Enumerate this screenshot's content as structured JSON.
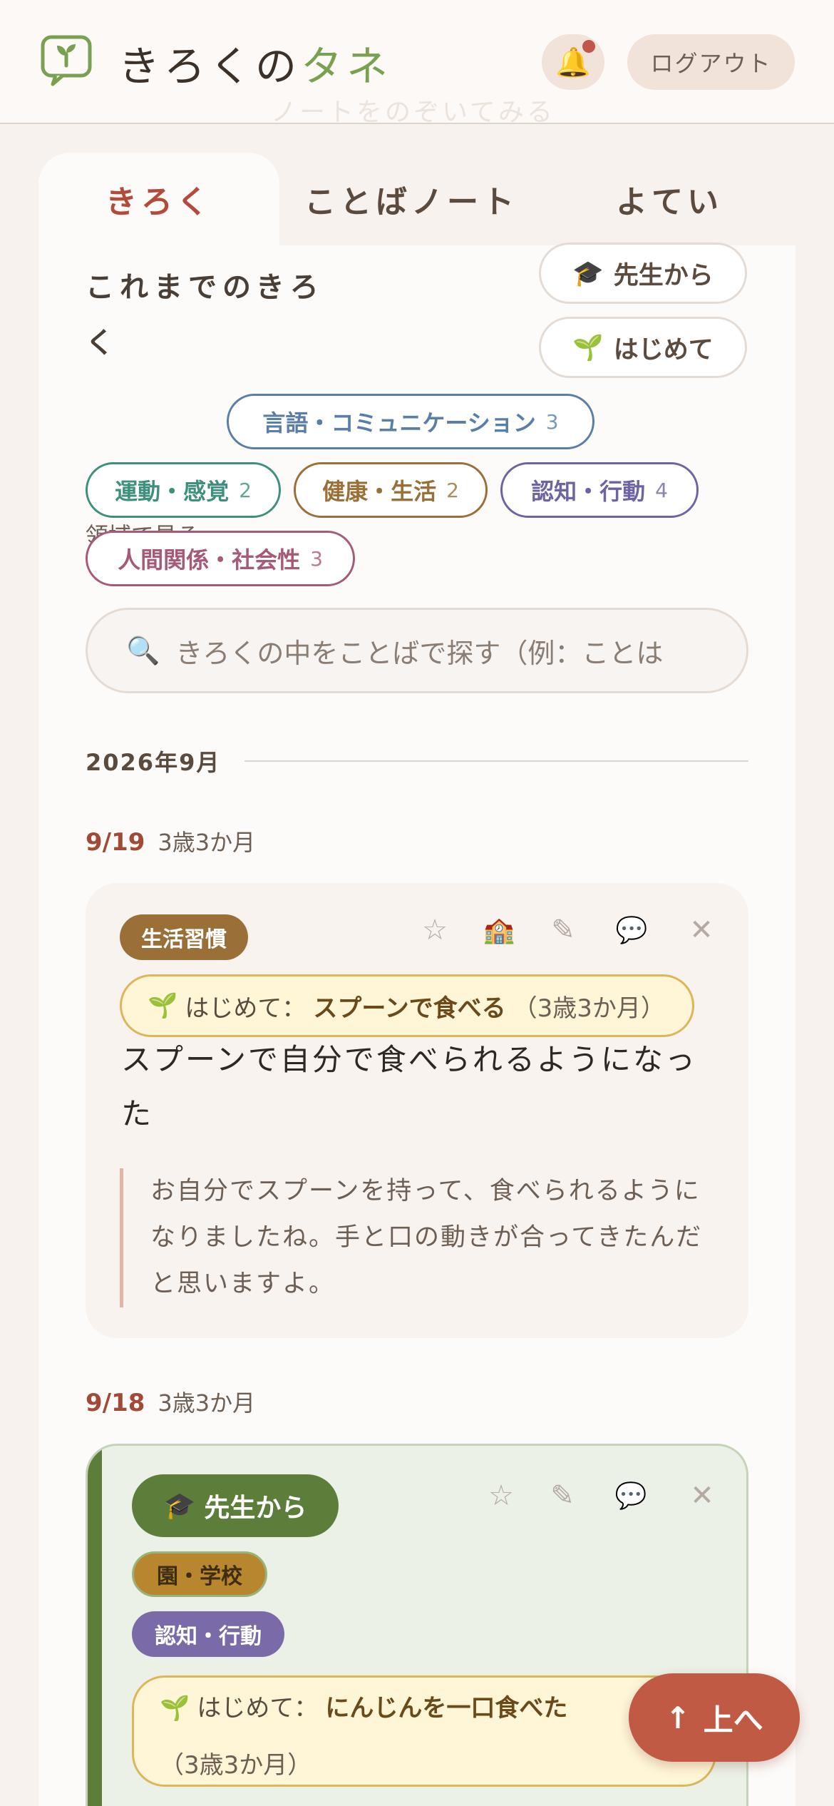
{
  "header": {
    "logo_text_main": "きろくの",
    "logo_text_accent": "タネ",
    "ghost_text": "ノートをのぞいてみる",
    "logout_label": "ログアウト",
    "colors": {
      "accent_green": "#7aa152",
      "notification_dot": "#c0574a"
    }
  },
  "tabs": [
    {
      "label": "きろく",
      "active": true
    },
    {
      "label": "ことばノート",
      "active": false
    },
    {
      "label": "よてい",
      "active": false
    }
  ],
  "section": {
    "title": "これまでのきろく",
    "filter_teacher": {
      "icon": "🎓",
      "label": "先生から"
    },
    "filter_first": {
      "icon": "🌱",
      "label": "はじめて"
    }
  },
  "domain_filter": {
    "label": "領域で見る",
    "chips": [
      {
        "label": "言語・コミュニケーション",
        "count": "3",
        "color": "#5a7ea8"
      },
      {
        "label": "運動・感覚",
        "count": "2",
        "color": "#3f8f7e"
      },
      {
        "label": "健康・生活",
        "count": "2",
        "color": "#9a6f38"
      },
      {
        "label": "認知・行動",
        "count": "4",
        "color": "#6f64a3"
      },
      {
        "label": "人間関係・社会性",
        "count": "3",
        "color": "#a55a7a"
      }
    ]
  },
  "search": {
    "placeholder": "きろくの中をことばで探す（例：ことは"
  },
  "month": "2026年9月",
  "entries": [
    {
      "date": "9/19",
      "age": "3歳3か月",
      "tag": "生活習慣",
      "first": {
        "prefix": "はじめて：",
        "what": "スプーンで食べる",
        "age": "（3歳3か月）"
      },
      "title": "スプーンで自分で食べられるようになった",
      "comment": "お自分でスプーンを持って、食べられるようになりましたね。手と口の動きが合ってきたんだと思いますよ。"
    },
    {
      "date": "9/18",
      "age": "3歳3か月",
      "teacher_label": "先生から",
      "tags": [
        "園・学校",
        "認知・行動"
      ],
      "first": {
        "prefix": "はじめて：",
        "what": "にんじんを一口食べた",
        "age": "（3歳3か月）"
      }
    }
  ],
  "up_button": "上へ"
}
